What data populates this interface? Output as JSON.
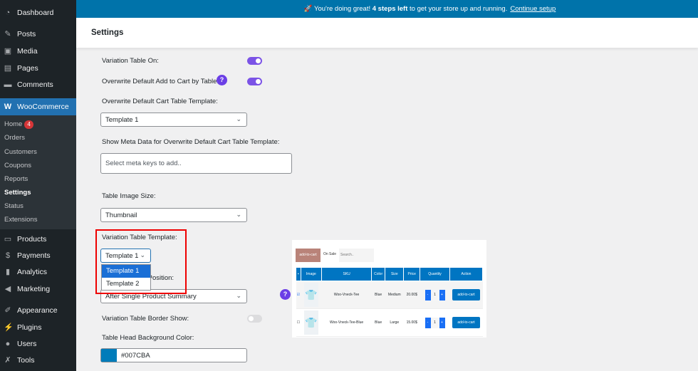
{
  "sidebar": {
    "items": [
      {
        "label": "Dashboard",
        "icon": "dashboard-icon"
      },
      {
        "label": "Posts",
        "icon": "pin-icon"
      },
      {
        "label": "Media",
        "icon": "media-icon"
      },
      {
        "label": "Pages",
        "icon": "pages-icon"
      },
      {
        "label": "Comments",
        "icon": "comment-icon"
      },
      {
        "label": "WooCommerce",
        "icon": "woo-icon"
      },
      {
        "label": "Products",
        "icon": "archive-icon"
      },
      {
        "label": "Payments",
        "icon": "dollar-icon"
      },
      {
        "label": "Analytics",
        "icon": "bar-chart-icon"
      },
      {
        "label": "Marketing",
        "icon": "megaphone-icon"
      },
      {
        "label": "Appearance",
        "icon": "brush-icon"
      },
      {
        "label": "Plugins",
        "icon": "plug-icon"
      },
      {
        "label": "Users",
        "icon": "user-icon"
      },
      {
        "label": "Tools",
        "icon": "wrench-icon"
      }
    ],
    "submenu": [
      {
        "label": "Home",
        "badge": "4"
      },
      {
        "label": "Orders"
      },
      {
        "label": "Customers"
      },
      {
        "label": "Coupons"
      },
      {
        "label": "Reports"
      },
      {
        "label": "Settings"
      },
      {
        "label": "Status"
      },
      {
        "label": "Extensions"
      }
    ]
  },
  "notice": {
    "prefix": "🚀 You're doing great!",
    "bold": "4 steps left",
    "suffix": "to get your store up and running.",
    "link": "Continue setup"
  },
  "header": {
    "title": "Settings"
  },
  "form": {
    "variation_table_on": "Variation Table On:",
    "overwrite_add_to_cart": "Overwrite Default Add to Cart by Table:",
    "help": "?",
    "cart_template_label": "Overwrite Default Cart Table Template:",
    "cart_template_value": "Template 1",
    "meta_label": "Show Meta Data for Overwrite Default Cart Table Template:",
    "meta_placeholder": "Select meta keys to add..",
    "image_size_label": "Table Image Size:",
    "image_size_value": "Thumbnail",
    "variation_template_label": "Variation Table Template:",
    "variation_template_value": "Template 1",
    "variation_template_options": [
      "Template 1",
      "Template 2"
    ],
    "position_label": "Variation Table Position:",
    "position_value": "After Single Product Summary",
    "border_label": "Variation Table Border Show:",
    "head_bg_label": "Table Head Background Color:",
    "head_bg_value": "#007CBA"
  },
  "preview": {
    "add_to_cart": "add-to-cart",
    "on_sale": "On Sale",
    "search": "Search..",
    "headers": [
      "",
      "Image",
      "SKU",
      "Color",
      "Size",
      "Price",
      "Quantity",
      "Action"
    ],
    "rows": [
      {
        "sku": "Woo-Vneck-Tee",
        "color": "Blue",
        "size": "Medium",
        "price": "20.00$",
        "qty": "1",
        "action": "add-to-cart"
      },
      {
        "sku": "Woo-Vneck-Tee-Blue",
        "color": "Blue",
        "size": "Large",
        "price": "15.00$",
        "qty": "1",
        "action": "add-to-cart"
      }
    ]
  },
  "colors": {
    "accent": "#2271b1",
    "toggle": "#7b53e6",
    "table_head": "#007CBA"
  }
}
